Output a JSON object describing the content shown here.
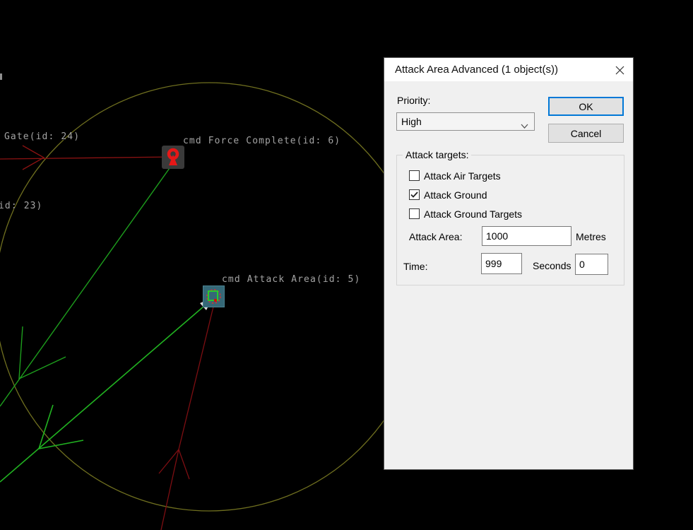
{
  "map": {
    "labels": {
      "gate": "Gate(id: 24)",
      "partial": "id: 23)",
      "force_complete": "cmd Force Complete(id: 6)",
      "attack_area": "cmd Attack Area(id: 5)"
    },
    "colors": {
      "background": "#000000",
      "range_circle": "#6f6f1f",
      "green_line": "#1fa31f",
      "red_line": "#8a1212",
      "label_text": "#a3a3a3",
      "force_complete_glyph": "#e61717",
      "attack_area_selection": "#356877"
    }
  },
  "dialog": {
    "title": "Attack Area Advanced (1 object(s))",
    "accent_color": "#0078d7",
    "priority": {
      "label": "Priority:",
      "value": "High"
    },
    "buttons": {
      "ok": "OK",
      "cancel": "Cancel"
    },
    "attack_targets": {
      "legend": "Attack targets:",
      "checkboxes": [
        {
          "label": "Attack Air Targets",
          "checked": false
        },
        {
          "label": "Attack Ground",
          "checked": true
        },
        {
          "label": "Attack Ground Targets",
          "checked": false
        }
      ],
      "attack_area": {
        "label": "Attack Area:",
        "value": "1000",
        "unit": "Metres"
      },
      "time": {
        "label": "Time:",
        "value": "999",
        "unit": "Seconds",
        "value2": "0"
      }
    }
  }
}
